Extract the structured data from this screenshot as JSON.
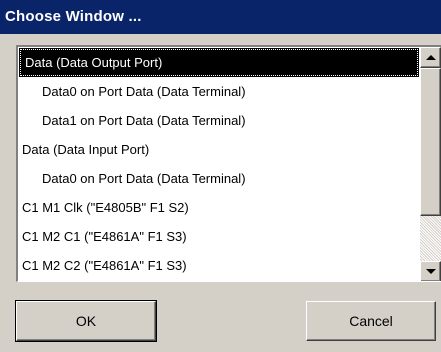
{
  "window": {
    "title": "Choose Window ..."
  },
  "list": {
    "items": [
      {
        "label": "Data (Data Output Port)",
        "selected": true
      },
      {
        "label": "Data0 on Port Data (Data Terminal)"
      },
      {
        "label": "Data1 on Port Data (Data Terminal)"
      },
      {
        "label": "Data (Data Input Port)"
      },
      {
        "label": "Data0 on Port Data (Data Terminal)"
      },
      {
        "label": "C1 M1 Clk (\"E4805B\" F1 S2)"
      },
      {
        "label": "C1 M2 C1 (\"E4861A\" F1 S3)"
      },
      {
        "label": "C1 M2 C2 (\"E4861A\" F1 S3)"
      }
    ]
  },
  "buttons": {
    "ok_label": "OK",
    "cancel_label": "Cancel"
  },
  "colors": {
    "titlebar": "#0a246a",
    "face": "#d4d0c8",
    "selection": "#000000"
  }
}
